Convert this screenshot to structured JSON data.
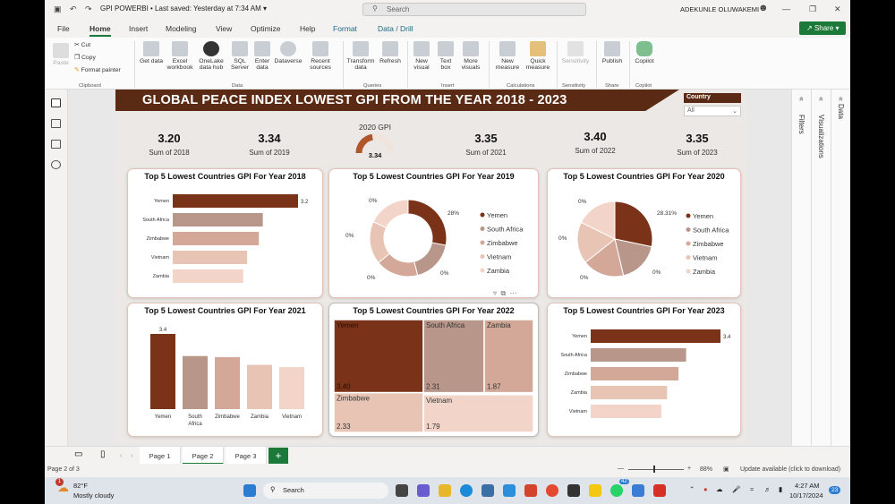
{
  "window": {
    "app_name": "GPI POWERBI",
    "save_status": "Last saved: Yesterday at 7:34 AM",
    "search_placeholder": "Search",
    "user": "ADEKUNLE OLUWAKEMI"
  },
  "menu": {
    "file": "File",
    "home": "Home",
    "insert": "Insert",
    "modeling": "Modeling",
    "view": "View",
    "optimize": "Optimize",
    "help": "Help",
    "format": "Format",
    "data_drill": "Data / Drill",
    "share": "Share"
  },
  "ribbon": {
    "paste": "Paste",
    "cut": "Cut",
    "copy": "Copy",
    "format_painter": "Format painter",
    "clipboard": "Clipboard",
    "get_data": "Get data",
    "excel_workbook": "Excel workbook",
    "onelake": "OneLake data hub",
    "sql_server": "SQL Server",
    "enter_data": "Enter data",
    "dataverse": "Dataverse",
    "recent_sources": "Recent sources",
    "data": "Data",
    "transform_data": "Transform data",
    "refresh": "Refresh",
    "queries": "Queries",
    "new_visual": "New visual",
    "text_box": "Text box",
    "more_visuals": "More visuals",
    "insert": "Insert",
    "new_measure": "New measure",
    "quick_measure": "Quick measure",
    "calculations": "Calculations",
    "sensitivity": "Sensitivity",
    "publish": "Publish",
    "share": "Share",
    "copilot": "Copilot"
  },
  "report": {
    "title": "GLOBAL PEACE INDEX LOWEST GPI FROM THE YEAR 2018 - 2023",
    "slicer": {
      "label": "Country",
      "value": "All"
    },
    "kpis": [
      {
        "value": "3.20",
        "label": "Sum of 2018"
      },
      {
        "value": "3.34",
        "label": "Sum of 2019"
      },
      {
        "value": "3.35",
        "label": "Sum of 2021"
      },
      {
        "value": "3.40",
        "label": "Sum of 2022"
      },
      {
        "value": "3.35",
        "label": "Sum of 2023"
      }
    ],
    "gauge": {
      "title": "2020 GPI",
      "value": "3.34",
      "fraction": 0.45
    },
    "colors": {
      "dark": "#7a3218",
      "c2": "#b9968a",
      "c3": "#d3a898",
      "c4": "#e8c4b4",
      "c5": "#f2d5c8",
      "accent": "#5b2a14"
    },
    "chart2018": {
      "title": "Top 5 Lowest Countries GPI For Year 2018"
    },
    "chart2019": {
      "title": "Top 5 Lowest Countries GPI For Year 2019"
    },
    "chart2020": {
      "title": "Top 5 Lowest Countries GPI For Year 2020"
    },
    "chart2021": {
      "title": "Top 5 Lowest Countries GPI For Year 2021"
    },
    "chart2022": {
      "title": "Top 5 Lowest Countries GPI For Year 2022"
    },
    "chart2023": {
      "title": "Top 5 Lowest Countries GPI For Year 2023"
    }
  },
  "chart_data": [
    {
      "type": "bar",
      "orientation": "horizontal",
      "title": "Top 5 Lowest Countries GPI For Year 2018",
      "categories": [
        "Yemen",
        "South Africa",
        "Zimbabwe",
        "Vietnam",
        "Zambia"
      ],
      "values": [
        3.2,
        2.3,
        2.2,
        1.9,
        1.8
      ],
      "data_labels": [
        "3.2",
        "",
        "",
        "",
        ""
      ]
    },
    {
      "type": "pie",
      "donut": true,
      "title": "Top 5 Lowest Countries GPI For Year 2019",
      "categories": [
        "Yemen",
        "South Africa",
        "Zimbabwe",
        "Vietnam",
        "Zambia"
      ],
      "values": [
        28,
        18,
        18,
        18,
        18
      ],
      "data_labels": [
        "28%",
        "0%",
        "0%",
        "0%",
        "0%"
      ],
      "legend": "right"
    },
    {
      "type": "pie",
      "title": "Top 5 Lowest Countries GPI For Year 2020",
      "categories": [
        "Yemen",
        "South Africa",
        "Zimbabwe",
        "Vietnam",
        "Zambia"
      ],
      "values": [
        28.31,
        18,
        18,
        18,
        17.69
      ],
      "data_labels": [
        "28.31%",
        "0%",
        "0%",
        "0%",
        "0%"
      ],
      "legend": "right"
    },
    {
      "type": "bar",
      "orientation": "vertical",
      "title": "Top 5 Lowest Countries GPI For Year 2021",
      "categories": [
        "Yemen",
        "South Africa",
        "Zimbabwe",
        "Zambia",
        "Vietnam"
      ],
      "values": [
        3.4,
        2.4,
        2.35,
        2.0,
        1.9
      ],
      "data_labels": [
        "3.4",
        "",
        "",
        "",
        ""
      ]
    },
    {
      "type": "treemap",
      "title": "Top 5 Lowest Countries GPI For Year 2022",
      "categories": [
        "Yemen",
        "South Africa",
        "Zambia",
        "Zimbabwe",
        "Vietnam"
      ],
      "values": [
        3.4,
        2.31,
        1.87,
        2.33,
        1.79
      ],
      "data_labels": [
        "3.40",
        "2.31",
        "1.87",
        "2.33",
        "1.79"
      ]
    },
    {
      "type": "bar",
      "orientation": "horizontal",
      "title": "Top 5 Lowest Countries GPI For Year 2023",
      "categories": [
        "Yemen",
        "South Africa",
        "Zimbabwe",
        "Zambia",
        "Vietnam"
      ],
      "values": [
        3.4,
        2.5,
        2.3,
        2.0,
        1.85
      ],
      "data_labels": [
        "3.4",
        "",
        "",
        "",
        ""
      ]
    }
  ],
  "panes": {
    "filters": "Filters",
    "visualizations": "Visualizations",
    "data": "Data"
  },
  "pages": {
    "tabs": [
      "Page 1",
      "Page 2",
      "Page 3"
    ],
    "add": "+"
  },
  "status": {
    "page": "Page 2 of 3",
    "zoom": "88%",
    "update": "Update available (click to download)"
  },
  "taskbar": {
    "temp": "82°F",
    "weather": "Mostly cloudy",
    "search": "Search",
    "time": "4:27 AM",
    "date": "10/17/2024",
    "badge": "23",
    "notif": "1",
    "chat_badge": "42"
  }
}
